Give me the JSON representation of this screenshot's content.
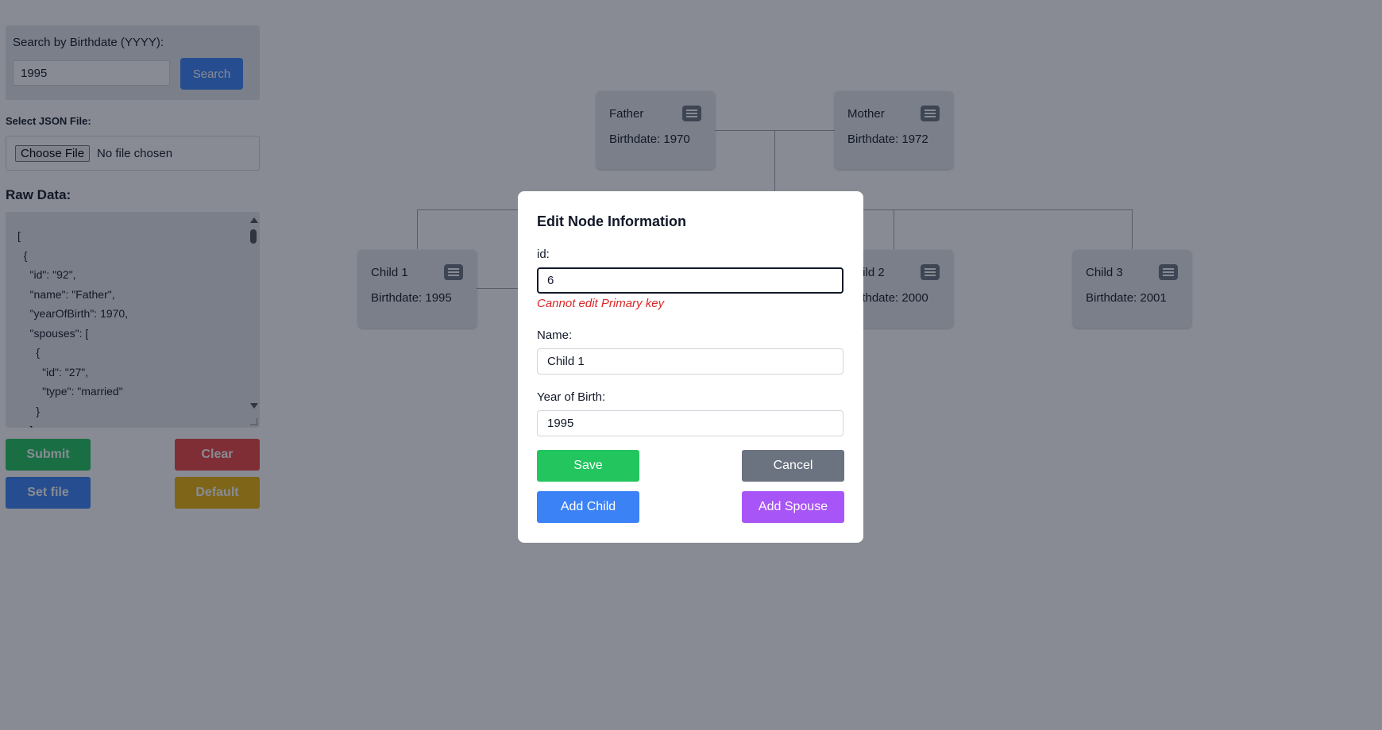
{
  "search": {
    "label": "Search by Birthdate (YYYY):",
    "value": "1995",
    "button": "Search"
  },
  "file": {
    "label": "Select JSON File:",
    "choose_button": "Choose File",
    "status": "No file chosen"
  },
  "raw": {
    "title": "Raw Data:",
    "text": "[\n  {\n    \"id\": \"92\",\n    \"name\": \"Father\",\n    \"yearOfBirth\": 1970,\n    \"spouses\": [\n      {\n        \"id\": \"27\",\n        \"type\": \"married\"\n      }\n    ]"
  },
  "actions": {
    "submit": "Submit",
    "clear": "Clear",
    "set_file": "Set file",
    "default": "Default"
  },
  "tree": {
    "nodes": [
      {
        "name": "Father",
        "birth": "Birthdate: 1970"
      },
      {
        "name": "Mother",
        "birth": "Birthdate: 1972"
      },
      {
        "name": "Child 1",
        "birth": "Birthdate: 1995"
      },
      {
        "name": "Child 2",
        "birth": "Birthdate: 2000"
      },
      {
        "name": "Child 3",
        "birth": "Birthdate: 2001"
      }
    ]
  },
  "modal": {
    "title": "Edit Node Information",
    "id_label": "id:",
    "id_value": "6",
    "id_error": "Cannot edit Primary key",
    "name_label": "Name:",
    "name_value": "Child 1",
    "year_label": "Year of Birth:",
    "year_value": "1995",
    "save": "Save",
    "cancel": "Cancel",
    "add_child": "Add Child",
    "add_spouse": "Add Spouse"
  },
  "colors": {
    "primary": "#3b82f6",
    "success": "#22c55e",
    "danger": "#ef4444",
    "warning": "#eab308",
    "secondary": "#6b7280",
    "purple": "#a855f7",
    "error_text": "#dc2626"
  }
}
